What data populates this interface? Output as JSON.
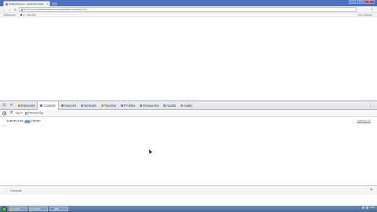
{
  "browser": {
    "tab_title": "Untitled Document - JavaScript Console",
    "url": "file:///C:/Users/ee/Desktop/NodeCourse/chapter8/examples/index.html",
    "new_tab_label": "+",
    "window_controls": {
      "minimize": "–",
      "maximize": "□",
      "close": "✕"
    },
    "nav": {
      "back": "‹",
      "forward": "›",
      "reload": "↻"
    },
    "menu_glyph": "≡",
    "bookmarks": [
      {
        "label": "Bookmarks"
      },
      {
        "label": "ee - Yahoo Mail"
      }
    ],
    "other_bookmarks": "Other bookmarks"
  },
  "devtools": {
    "tabs": [
      {
        "label": "Elements",
        "color": "#d9822b"
      },
      {
        "label": "Console",
        "color": "#3b73c9",
        "active": true
      },
      {
        "label": "Sources",
        "color": "#7a7a7a"
      },
      {
        "label": "Network",
        "color": "#4b9bd6"
      },
      {
        "label": "Timeline",
        "color": "#c9a23b"
      },
      {
        "label": "Profiles",
        "color": "#8a6bbd"
      },
      {
        "label": "Resources",
        "color": "#5a9a5a"
      },
      {
        "label": "Audits",
        "color": "#6b8fbd"
      },
      {
        "label": "Audio",
        "color": "#999999"
      }
    ],
    "dock_glyph": "⊡",
    "close_glyph": "✕",
    "search_glyph": "⋮",
    "filter": {
      "scope_label": "top",
      "scope_arrow": "▾",
      "preserve_log_label": "Preserve log",
      "filter_glyph": "⧩"
    },
    "log_entries": [
      {
        "prefix": "1 ",
        "text_before": "save ",
        "text_mid": "true",
        "text_after": " Yahoo",
        "source": "index.js:43"
      }
    ],
    "prompt": ">",
    "drawer": {
      "label": "Console",
      "icon": "⋮",
      "close": "✕"
    }
  },
  "taskbar": {
    "items": [
      {
        "label": "Chrome"
      },
      {
        "label": "Explorer"
      },
      {
        "label": "Editor"
      }
    ],
    "clock": "12:00"
  }
}
